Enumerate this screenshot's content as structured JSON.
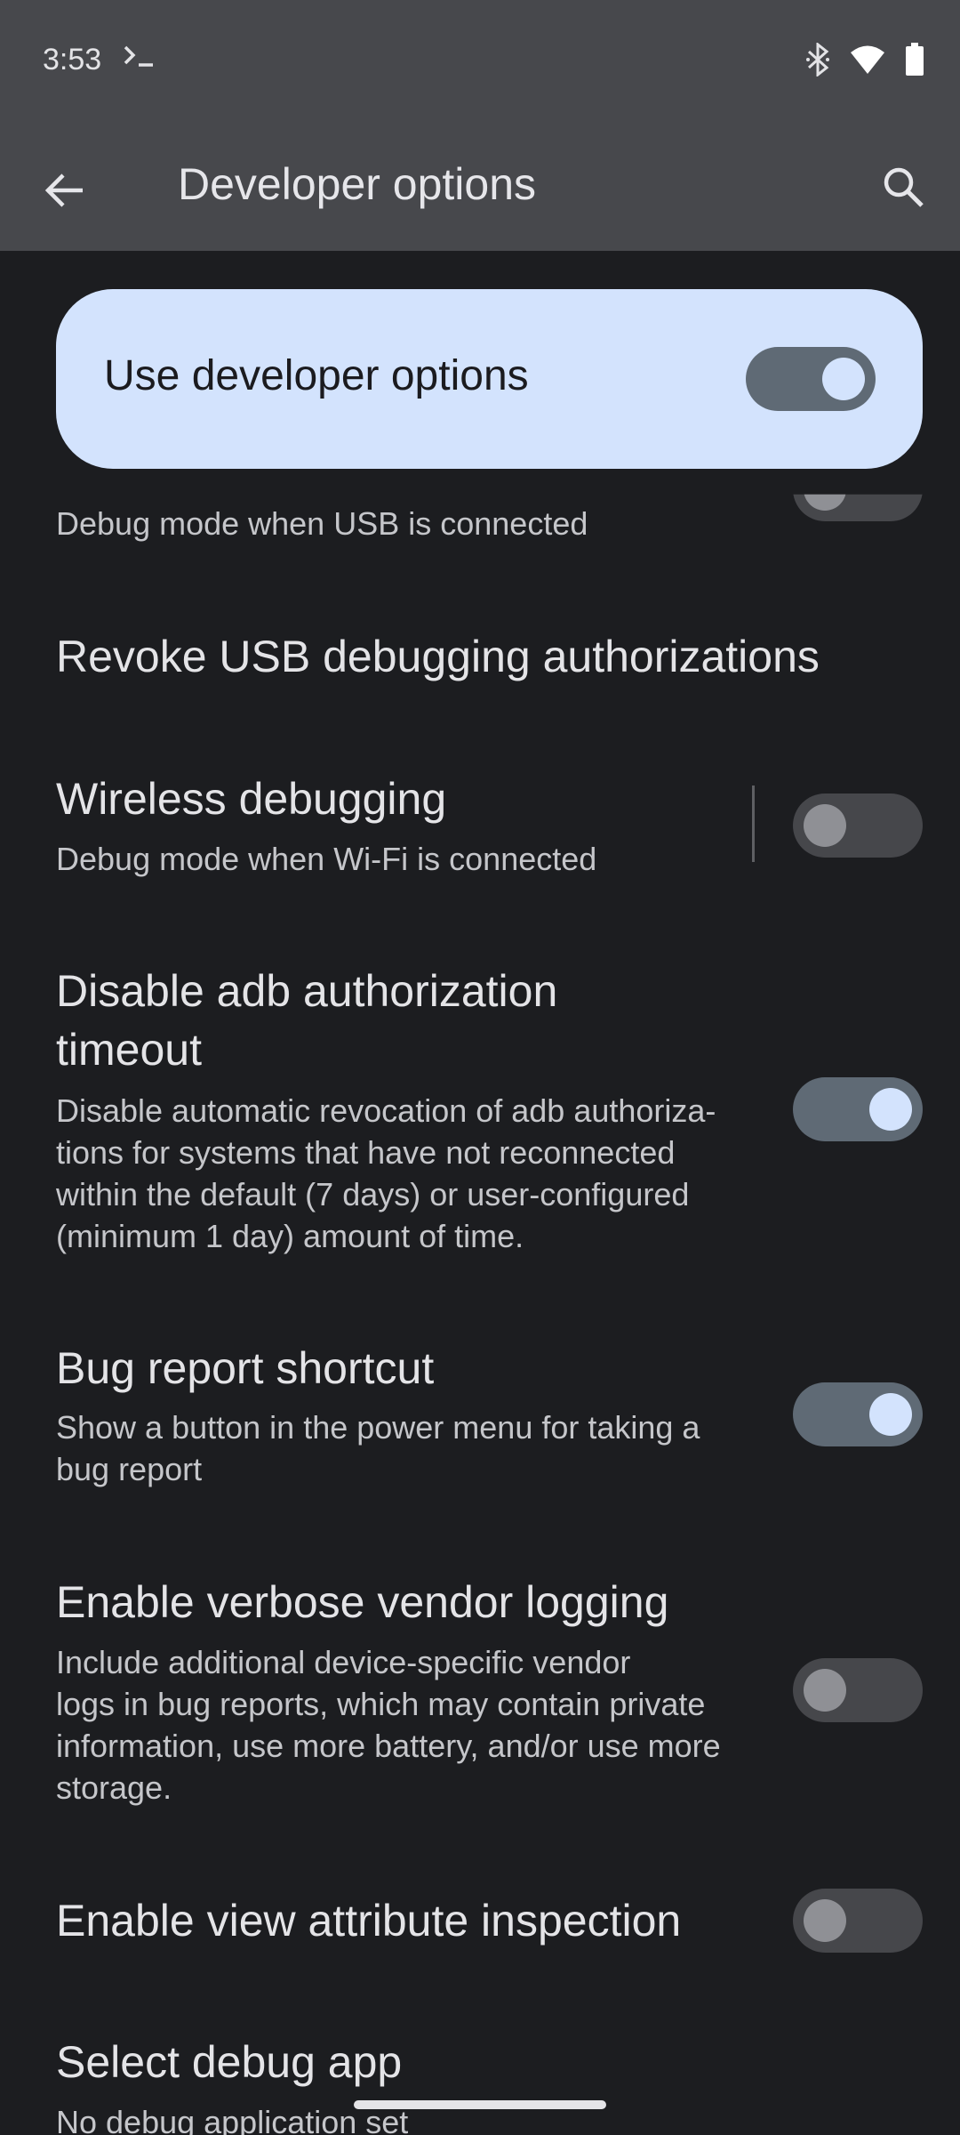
{
  "status_bar": {
    "time": "3:53",
    "terminal_icon": "terminal-icon",
    "icons": [
      "bluetooth-icon",
      "wifi-icon",
      "battery-icon"
    ]
  },
  "app_bar": {
    "title": "Developer options",
    "back_icon": "arrow-back-icon",
    "search_icon": "search-icon"
  },
  "master_switch": {
    "label": "Use developer options",
    "checked": true
  },
  "settings": {
    "usb_debugging": {
      "summary": "Debug mode when USB is connected"
    },
    "revoke_usb": {
      "title": "Revoke USB debugging authorizations"
    },
    "wireless_debugging": {
      "title": "Wireless debugging",
      "summary": "Debug mode when Wi-Fi is connected",
      "checked": false
    },
    "disable_adb_timeout": {
      "title_line1": "Disable adb authorization",
      "title_line2": "timeout",
      "summary_line1": "Disable automatic revocation of adb authoriza-",
      "summary_line2": "tions for systems that have not reconnected",
      "summary_line3": "within the default (7 days) or user-configured",
      "summary_line4": "(minimum 1 day) amount of time.",
      "checked": true
    },
    "bug_report_shortcut": {
      "title": "Bug report shortcut",
      "summary_line1": "Show a button in the power menu for taking a",
      "summary_line2": "bug report",
      "checked": true
    },
    "verbose_vendor_logging": {
      "title": "Enable verbose vendor logging",
      "summary_line1": "Include additional device-specific vendor",
      "summary_line2": "logs in bug reports, which may contain private",
      "summary_line3": "information, use more battery, and/or use more",
      "summary_line4": "storage.",
      "checked": false
    },
    "view_attribute_inspection": {
      "title": "Enable view attribute inspection",
      "checked": false
    },
    "select_debug_app": {
      "title": "Select debug app",
      "summary": "No debug application set"
    }
  }
}
